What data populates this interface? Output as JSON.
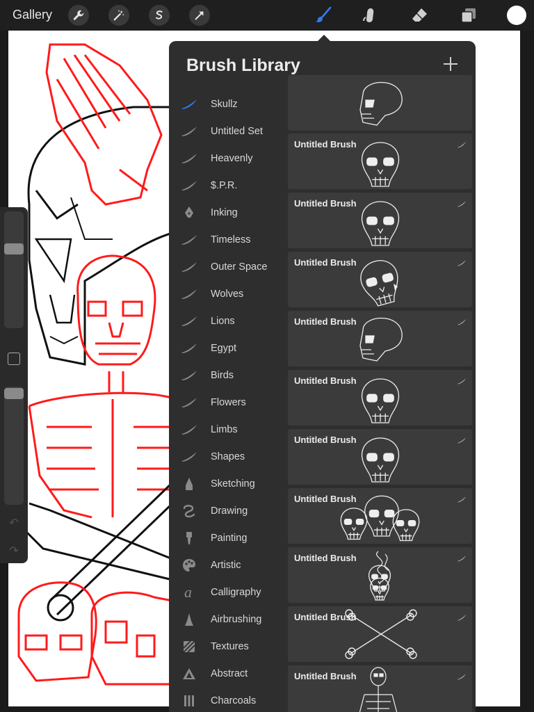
{
  "toolbar": {
    "gallery_label": "Gallery",
    "left_tools": [
      "wrench-icon",
      "magic-wand-icon",
      "selection-s-icon",
      "transform-arrow-icon"
    ],
    "right_tools": [
      "brush-icon",
      "smudge-icon",
      "eraser-icon",
      "layers-icon"
    ],
    "active_tool": "brush-icon",
    "accent_color": "#2f7cf6",
    "current_color": "#ffffff"
  },
  "panel": {
    "title": "Brush Library",
    "add_icon": "plus-icon"
  },
  "brush_sets": [
    {
      "label": "Skullz",
      "icon": "brush-stroke-icon",
      "selected": true
    },
    {
      "label": "Untitled Set",
      "icon": "brush-stroke-icon"
    },
    {
      "label": "Heavenly",
      "icon": "brush-stroke-icon"
    },
    {
      "label": "$.P.R.",
      "icon": "brush-stroke-icon"
    },
    {
      "label": "Inking",
      "icon": "pen-nib-icon"
    },
    {
      "label": "Timeless",
      "icon": "brush-stroke-icon"
    },
    {
      "label": "Outer Space",
      "icon": "brush-stroke-icon"
    },
    {
      "label": "Wolves",
      "icon": "brush-stroke-icon"
    },
    {
      "label": "Lions",
      "icon": "brush-stroke-icon"
    },
    {
      "label": "Egypt",
      "icon": "brush-stroke-icon"
    },
    {
      "label": "Birds",
      "icon": "brush-stroke-icon"
    },
    {
      "label": "Flowers",
      "icon": "brush-stroke-icon"
    },
    {
      "label": "Limbs",
      "icon": "brush-stroke-icon"
    },
    {
      "label": "Shapes",
      "icon": "brush-stroke-icon"
    },
    {
      "label": "Sketching",
      "icon": "pencil-tip-icon"
    },
    {
      "label": "Drawing",
      "icon": "squiggle-icon"
    },
    {
      "label": "Painting",
      "icon": "paint-brush-icon"
    },
    {
      "label": "Artistic",
      "icon": "palette-icon"
    },
    {
      "label": "Calligraphy",
      "icon": "calligraphy-a-icon"
    },
    {
      "label": "Airbrushing",
      "icon": "airbrush-icon"
    },
    {
      "label": "Textures",
      "icon": "texture-icon"
    },
    {
      "label": "Abstract",
      "icon": "triangle-icon"
    },
    {
      "label": "Charcoals",
      "icon": "charcoal-icon"
    }
  ],
  "brushes": [
    {
      "name": "",
      "preview": "skull-side-icon"
    },
    {
      "name": "Untitled Brush",
      "preview": "skull-front-icon"
    },
    {
      "name": "Untitled Brush",
      "preview": "skull-front-icon"
    },
    {
      "name": "Untitled Brush",
      "preview": "skull-tilted-icon"
    },
    {
      "name": "Untitled Brush",
      "preview": "skull-side-icon"
    },
    {
      "name": "Untitled Brush",
      "preview": "skull-front-icon"
    },
    {
      "name": "Untitled Brush",
      "preview": "skull-front-icon"
    },
    {
      "name": "Untitled Brush",
      "preview": "three-skulls-icon"
    },
    {
      "name": "Untitled Brush",
      "preview": "skull-smoke-icon"
    },
    {
      "name": "Untitled Brush",
      "preview": "crossbones-icon"
    },
    {
      "name": "Untitled Brush",
      "preview": "skeleton-icon"
    }
  ]
}
